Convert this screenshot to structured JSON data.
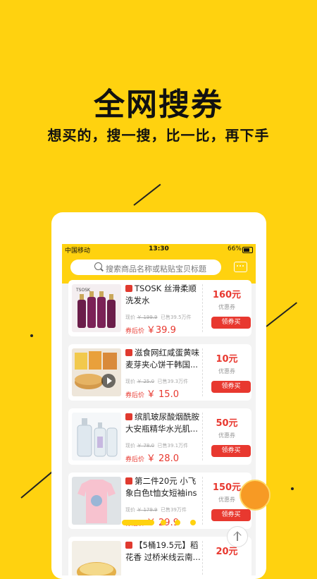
{
  "promo": {
    "headline": "全网搜券",
    "subline": "想买的，搜一搜，比一比，再下手"
  },
  "statusbar": {
    "carrier": "中国移动",
    "time": "13:30",
    "battery": "66%"
  },
  "search": {
    "placeholder": "搜索商品名称或粘贴宝贝标题"
  },
  "products": [
    {
      "title": "TSOSK 丝滑柔顺洗发水",
      "orig_label": "现价",
      "orig_price": "￥ 199.9",
      "sold": "已售39.5万件",
      "after_label": "券后价",
      "after_price": "￥39.9",
      "coupon": "160元",
      "coupon_label": "优惠券",
      "claim": "领券买"
    },
    {
      "title": "滋食网红咸蛋黄味麦芽夹心饼干韩国...",
      "orig_label": "现价",
      "orig_price": "￥ 25.0",
      "sold": "已售39.3万件",
      "after_label": "券后价",
      "after_price": "￥ 15.0",
      "coupon": "10元",
      "coupon_label": "优惠券",
      "claim": "领券买"
    },
    {
      "title": "缤肌玻尿酸烟酰胺大安瓶精华水光肌...",
      "orig_label": "现价",
      "orig_price": "￥ 78.0",
      "sold": "已售39.1万件",
      "after_label": "券后价",
      "after_price": "￥ 28.0",
      "coupon": "50元",
      "coupon_label": "优惠券",
      "claim": "领券买"
    },
    {
      "title": "第二件20元 小飞象白色t恤女短袖ins短...",
      "orig_label": "现价",
      "orig_price": "￥ 179.9",
      "sold": "已售39万件",
      "after_label": "券后价",
      "after_price": "￥ 29.9",
      "coupon": "150元",
      "coupon_label": "优惠券",
      "claim": "领券买"
    },
    {
      "title": "【5桶19.5元】稻花香 过桥米线云南...",
      "orig_label": "",
      "orig_price": "",
      "sold": "",
      "after_label": "",
      "after_price": "",
      "coupon": "20元",
      "coupon_label": "",
      "claim": ""
    }
  ],
  "colors": {
    "brand_yellow": "#FFD20F",
    "accent_red": "#E8382F"
  },
  "icons": {
    "search": "search-icon",
    "message": "message-icon",
    "play": "play-icon",
    "scroll_top": "arrow-up-icon"
  }
}
